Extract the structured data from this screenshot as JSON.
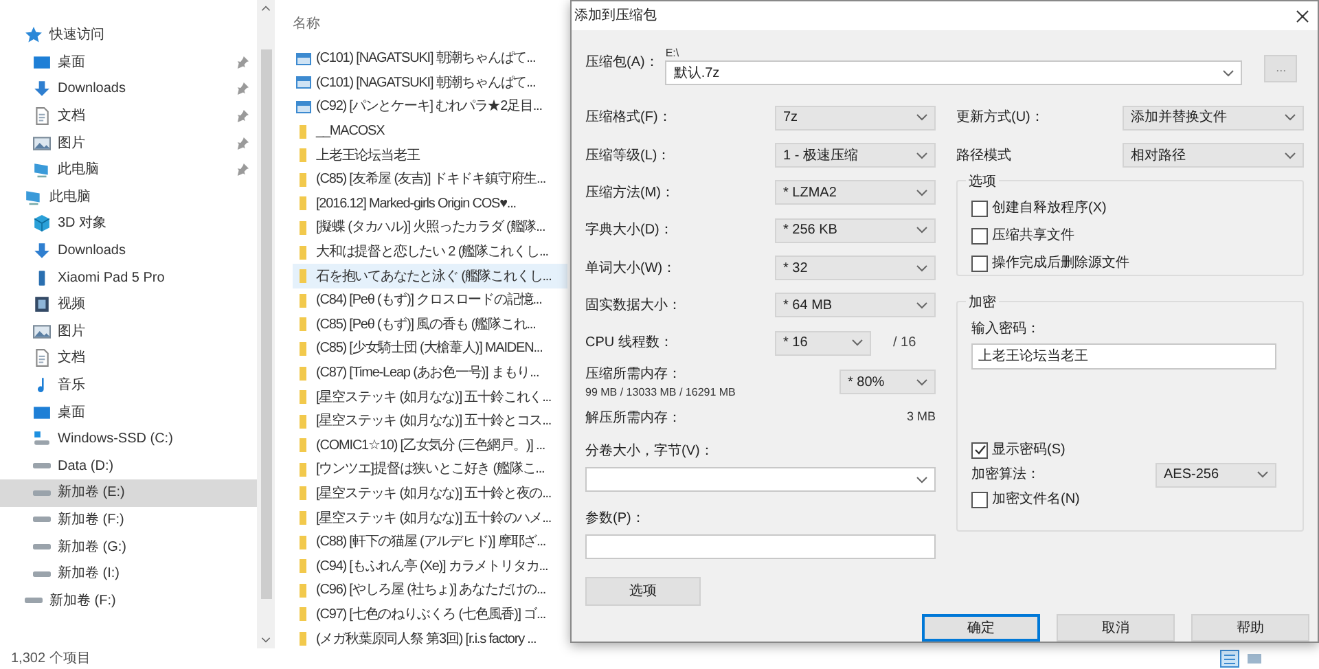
{
  "explorer": {
    "nav": [
      {
        "label": "快速访问",
        "kind": "star",
        "group": true,
        "pinned": false,
        "selected": false
      },
      {
        "label": "桌面",
        "kind": "desktop",
        "group": false,
        "pinned": true,
        "selected": false
      },
      {
        "label": "Downloads",
        "kind": "download",
        "group": false,
        "pinned": true,
        "selected": false
      },
      {
        "label": "文档",
        "kind": "document",
        "group": false,
        "pinned": true,
        "selected": false
      },
      {
        "label": "图片",
        "kind": "image",
        "group": false,
        "pinned": true,
        "selected": false
      },
      {
        "label": "此电脑",
        "kind": "computer",
        "group": false,
        "pinned": true,
        "selected": false
      },
      {
        "label": "此电脑",
        "kind": "computer",
        "group": true,
        "pinned": false,
        "selected": false
      },
      {
        "label": "3D 对象",
        "kind": "cube",
        "group": false,
        "pinned": false,
        "selected": false
      },
      {
        "label": "Downloads",
        "kind": "download",
        "group": false,
        "pinned": false,
        "selected": false
      },
      {
        "label": "Xiaomi Pad 5 Pro",
        "kind": "tablet",
        "group": false,
        "pinned": false,
        "selected": false
      },
      {
        "label": "视频",
        "kind": "video",
        "group": false,
        "pinned": false,
        "selected": false
      },
      {
        "label": "图片",
        "kind": "image",
        "group": false,
        "pinned": false,
        "selected": false
      },
      {
        "label": "文档",
        "kind": "document",
        "group": false,
        "pinned": false,
        "selected": false
      },
      {
        "label": "音乐",
        "kind": "music",
        "group": false,
        "pinned": false,
        "selected": false
      },
      {
        "label": "桌面",
        "kind": "desktop",
        "group": false,
        "pinned": false,
        "selected": false
      },
      {
        "label": "Windows-SSD (C:)",
        "kind": "system-drive",
        "group": false,
        "pinned": false,
        "selected": false
      },
      {
        "label": "Data (D:)",
        "kind": "drive",
        "group": false,
        "pinned": false,
        "selected": false
      },
      {
        "label": "新加卷 (E:)",
        "kind": "drive",
        "group": false,
        "pinned": false,
        "selected": true
      },
      {
        "label": "新加卷 (F:)",
        "kind": "drive",
        "group": false,
        "pinned": false,
        "selected": false
      },
      {
        "label": "新加卷 (G:)",
        "kind": "drive",
        "group": false,
        "pinned": false,
        "selected": false
      },
      {
        "label": "新加卷 (I:)",
        "kind": "drive",
        "group": false,
        "pinned": false,
        "selected": false
      },
      {
        "label": "新加卷 (F:)",
        "kind": "drive",
        "group": true,
        "pinned": false,
        "selected": false
      }
    ],
    "column_header": "名称",
    "files": [
      {
        "name": "(C101) [NAGATSUKI] 朝潮ちゃんぱて...",
        "kind": "archive",
        "selected": false
      },
      {
        "name": "(C101) [NAGATSUKI] 朝潮ちゃんぱて...",
        "kind": "archive",
        "selected": false
      },
      {
        "name": "(C92) [パンとケーキ] むれパラ★2足目...",
        "kind": "archive",
        "selected": false
      },
      {
        "name": "__MACOSX",
        "kind": "folder",
        "selected": false
      },
      {
        "name": "上老王论坛当老王",
        "kind": "folder",
        "selected": false
      },
      {
        "name": "(C85) [友希屋 (友吉)] ドキドキ鎮守府生...",
        "kind": "folder",
        "selected": false
      },
      {
        "name": "[2016.12] Marked-girls Origin COS♥...",
        "kind": "folder",
        "selected": false
      },
      {
        "name": "[擬蝶 (タカハル)] 火照ったカラダ (艦隊...",
        "kind": "folder",
        "selected": false
      },
      {
        "name": "大和は提督と恋したい 2 (艦隊これくし...",
        "kind": "folder",
        "selected": false
      },
      {
        "name": "石を抱いてあなたと泳ぐ (艦隊これくし...",
        "kind": "folder",
        "selected": true
      },
      {
        "name": "(C84) [Peθ (もず)] クロスロードの記憶...",
        "kind": "folder",
        "selected": false
      },
      {
        "name": "(C85) [Peθ (もず)] 風の香も (艦隊これ...",
        "kind": "folder",
        "selected": false
      },
      {
        "name": "(C85) [少女騎士団 (大槍葦人)] MAIDEN...",
        "kind": "folder",
        "selected": false
      },
      {
        "name": "(C87) [Time-Leap (あお色一号)] まもり...",
        "kind": "folder",
        "selected": false
      },
      {
        "name": "[星空ステッキ (如月なな)] 五十鈴これく...",
        "kind": "folder",
        "selected": false
      },
      {
        "name": "[星空ステッキ (如月なな)] 五十鈴とコス...",
        "kind": "folder",
        "selected": false
      },
      {
        "name": "(COMIC1☆10) [乙女気分 (三色網戸。)] ...",
        "kind": "folder",
        "selected": false
      },
      {
        "name": "[ウンツエ]提督は狭いとこ好き (艦隊こ...",
        "kind": "folder",
        "selected": false
      },
      {
        "name": "[星空ステッキ (如月なな)] 五十鈴と夜の...",
        "kind": "folder",
        "selected": false
      },
      {
        "name": "[星空ステッキ (如月なな)] 五十鈴のハメ...",
        "kind": "folder",
        "selected": false
      },
      {
        "name": "(C88) [軒下の猫屋 (アルデヒド)] 摩耶ざ...",
        "kind": "folder",
        "selected": false
      },
      {
        "name": "(C94) [もふれん亭 (Xe)] カラメトリタカ...",
        "kind": "folder",
        "selected": false
      },
      {
        "name": "(C96) [やしろ屋 (社ちょ)] あなただけの...",
        "kind": "folder",
        "selected": false
      },
      {
        "name": "(C97) [七色のねりぶくろ (七色風香)] ゴ...",
        "kind": "folder",
        "selected": false
      },
      {
        "name": "(メガ秋葉原同人祭 第3回) [r.i.s factory ...",
        "kind": "folder",
        "selected": false
      }
    ],
    "status": "1,302 个项目"
  },
  "dialog": {
    "title": "添加到压缩包",
    "archive": {
      "label": "压缩包(A)：",
      "path": "E:\\",
      "value": "默认.7z",
      "browse": "..."
    },
    "settings": [
      {
        "label": "压缩格式(F)：",
        "value": "7z"
      },
      {
        "label": "压缩等级(L)：",
        "value": "1 - 极速压缩"
      },
      {
        "label": "压缩方法(M)：",
        "value": "* LZMA2"
      },
      {
        "label": "字典大小(D)：",
        "value": "* 256 KB"
      },
      {
        "label": "单词大小(W)：",
        "value": "* 32"
      },
      {
        "label": "固实数据大小：",
        "value": "* 64 MB"
      }
    ],
    "threads": {
      "label": "CPU 线程数：",
      "value": "* 16",
      "max": "/ 16"
    },
    "memory": {
      "label": "压缩所需内存：",
      "detail": "99 MB / 13033 MB / 16291 MB",
      "value": "* 80%"
    },
    "decompress": {
      "label": "解压所需内存：",
      "value": "3 MB"
    },
    "split": {
      "label": "分卷大小，字节(V)："
    },
    "params": {
      "label": "参数(P)："
    },
    "options_button": "选项",
    "update": {
      "label": "更新方式(U)：",
      "value": "添加并替换文件"
    },
    "path_mode": {
      "label": "路径模式",
      "value": "相对路径"
    },
    "options": {
      "title": "选项",
      "items": [
        {
          "label": "创建自释放程序(X)",
          "checked": false
        },
        {
          "label": "压缩共享文件",
          "checked": false
        },
        {
          "label": "操作完成后删除源文件",
          "checked": false
        }
      ]
    },
    "encryption": {
      "title": "加密",
      "password_label": "输入密码：",
      "password": "上老王论坛当老王",
      "show_password": {
        "label": "显示密码(S)",
        "checked": true
      },
      "method_label": "加密算法：",
      "method": "AES-256",
      "encrypt_names": {
        "label": "加密文件名(N)",
        "checked": false
      }
    },
    "buttons": [
      {
        "label": "确定",
        "default": true
      },
      {
        "label": "取消",
        "default": false
      },
      {
        "label": "帮助",
        "default": false
      }
    ]
  }
}
